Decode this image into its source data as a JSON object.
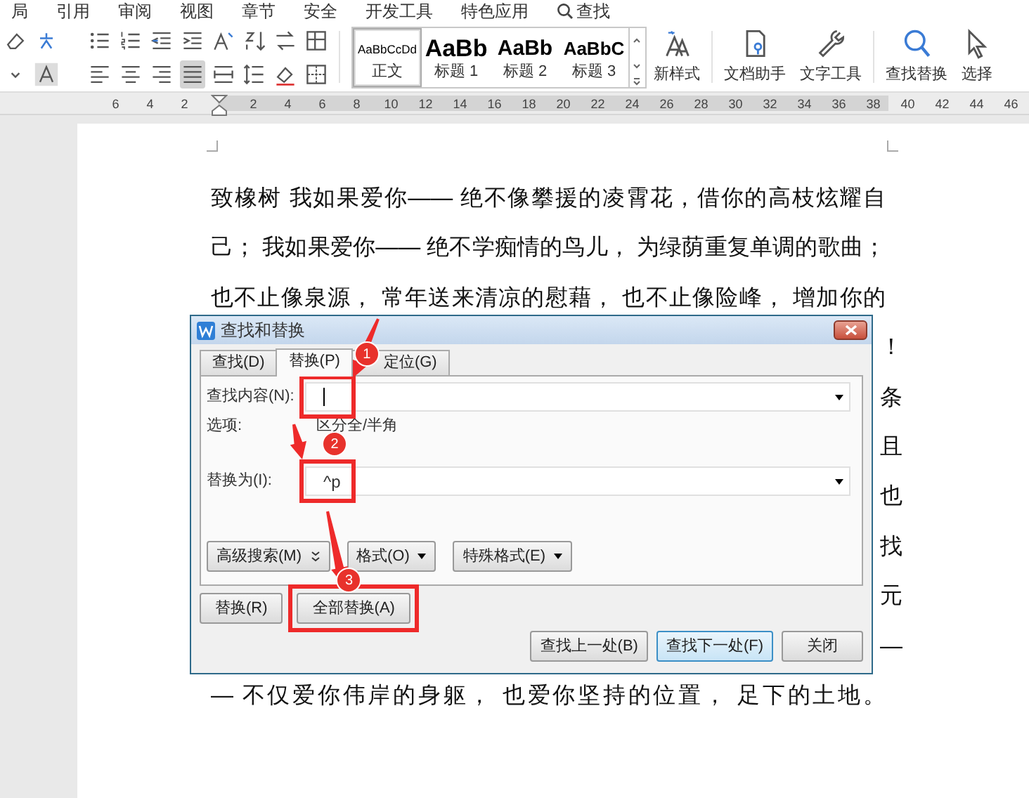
{
  "menu_bar": {
    "items": [
      "局",
      "引用",
      "审阅",
      "视图",
      "章节",
      "安全",
      "开发工具",
      "特色应用"
    ],
    "search": "查找"
  },
  "toolbar": {
    "styles": [
      {
        "preview": "AaBbCcDd",
        "label": "正文",
        "kind": "body",
        "selected": true
      },
      {
        "preview": "AaBb",
        "label": "标题 1",
        "kind": "h1",
        "selected": false
      },
      {
        "preview": "AaBb",
        "label": "标题 2",
        "kind": "h2",
        "selected": false
      },
      {
        "preview": "AaBbC",
        "label": "标题 3",
        "kind": "h3",
        "selected": false
      }
    ],
    "buttons": [
      {
        "label": "新样式",
        "kind": "new-style"
      },
      {
        "label": "文档助手",
        "kind": "assistant"
      },
      {
        "label": "文字工具",
        "kind": "tools"
      },
      {
        "label": "查找替换",
        "kind": "find"
      },
      {
        "label": "选择",
        "kind": "select"
      }
    ]
  },
  "ruler": {
    "left_ticks": [
      "6",
      "4",
      "2"
    ],
    "right_ticks": [
      "2",
      "4",
      "6",
      "8",
      "10",
      "12",
      "14",
      "16",
      "18",
      "20",
      "22",
      "24",
      "26",
      "28",
      "30",
      "32",
      "34",
      "36",
      "38",
      "40",
      "42",
      "44",
      "46"
    ]
  },
  "document": {
    "lines": [
      {
        "kind": "full",
        "text": "致橡树 我如果爱你—— 绝不像攀援的凌霄花，借你的高枝炫耀自"
      },
      {
        "kind": "full",
        "text": "己； 我如果爱你—— 绝不学痴情的鸟儿， 为绿荫重复单调的歌曲；"
      },
      {
        "kind": "full",
        "text": "也不止像泉源， 常年送来清凉的慰藉， 也不止像险峰， 增加你的"
      },
      {
        "kind": "tail",
        "text": "！"
      },
      {
        "kind": "tail",
        "text": "条"
      },
      {
        "kind": "tail",
        "text": "且"
      },
      {
        "kind": "tail",
        "text": "也"
      },
      {
        "kind": "tail",
        "text": "找"
      },
      {
        "kind": "tail",
        "text": "元"
      },
      {
        "kind": "tail",
        "text": "—"
      },
      {
        "kind": "full",
        "text": "— 不仅爱你伟岸的身躯， 也爱你坚持的位置， 足下的土地。"
      }
    ]
  },
  "dialog": {
    "title": "查找和替换",
    "tabs": [
      {
        "label": "查找(D)",
        "selected": false
      },
      {
        "label": "替换(P)",
        "selected": true
      },
      {
        "label": "定位(G)",
        "selected": false
      }
    ],
    "find": {
      "label": "查找内容(N):",
      "focused": true
    },
    "options": {
      "label": "选项:",
      "value": "区分全/半角"
    },
    "replace": {
      "label": "替换为(I):",
      "value": "^p"
    },
    "panel_buttons": [
      {
        "label": "高级搜索(M)",
        "kind": "expand"
      },
      {
        "label": "格式(O)",
        "kind": "dropdown"
      },
      {
        "label": "特殊格式(E)",
        "kind": "dropdown"
      }
    ],
    "action_buttons": [
      {
        "label": "替换(R)"
      },
      {
        "label": "全部替换(A)"
      }
    ],
    "footer_buttons": [
      {
        "label": "查找上一处(B)",
        "default": false
      },
      {
        "label": "查找下一处(F)",
        "default": true
      },
      {
        "label": "关闭",
        "default": false
      }
    ]
  },
  "annotations": [
    {
      "number": "1"
    },
    {
      "number": "2"
    },
    {
      "number": "3"
    }
  ]
}
